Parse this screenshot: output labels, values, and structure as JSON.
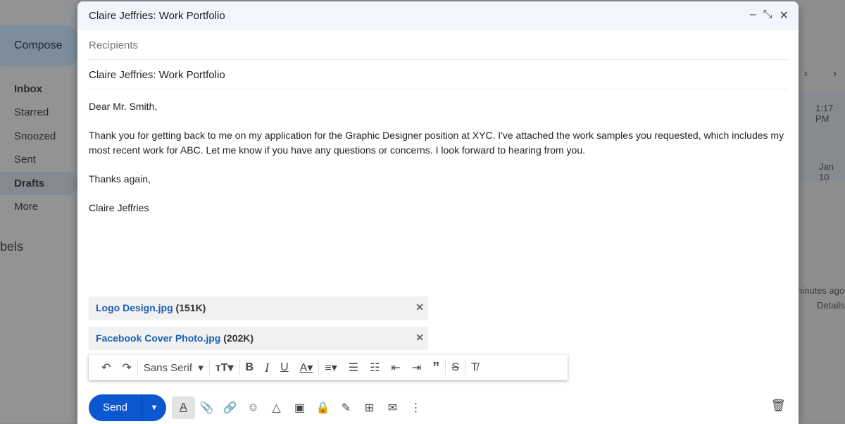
{
  "sidebar": {
    "compose": "Compose",
    "items": [
      {
        "label": "Inbox"
      },
      {
        "label": "Starred"
      },
      {
        "label": "Snoozed"
      },
      {
        "label": "Sent"
      },
      {
        "label": "Drafts",
        "active": true
      },
      {
        "label": "More"
      }
    ],
    "labels_heading": "bels"
  },
  "list": {
    "times": [
      "1:17 PM",
      "Jan 10"
    ],
    "activity": "ninutes ago",
    "details": "Details"
  },
  "compose": {
    "title": "Claire Jeffries: Work Portfolio",
    "recipients_placeholder": "Recipients",
    "subject": "Claire Jeffries: Work Portfolio",
    "body": [
      "Dear Mr. Smith,",
      "Thank you for getting back to me on my application for the Graphic Designer position at XYC. I've attached the work samples you requested, which includes my most recent work for ABC. Let me know if you have any questions or concerns. I look forward to hearing from you.",
      "Thanks again,",
      "Claire Jeffries"
    ],
    "attachments": [
      {
        "name": "Logo Design.jpg",
        "size": "(151K)"
      },
      {
        "name": "Facebook Cover Photo.jpg",
        "size": "(202K)"
      }
    ],
    "font": "Sans Serif",
    "send": "Send"
  },
  "colors": {
    "send": "#0b57d0",
    "link": "#1a5fb4"
  }
}
